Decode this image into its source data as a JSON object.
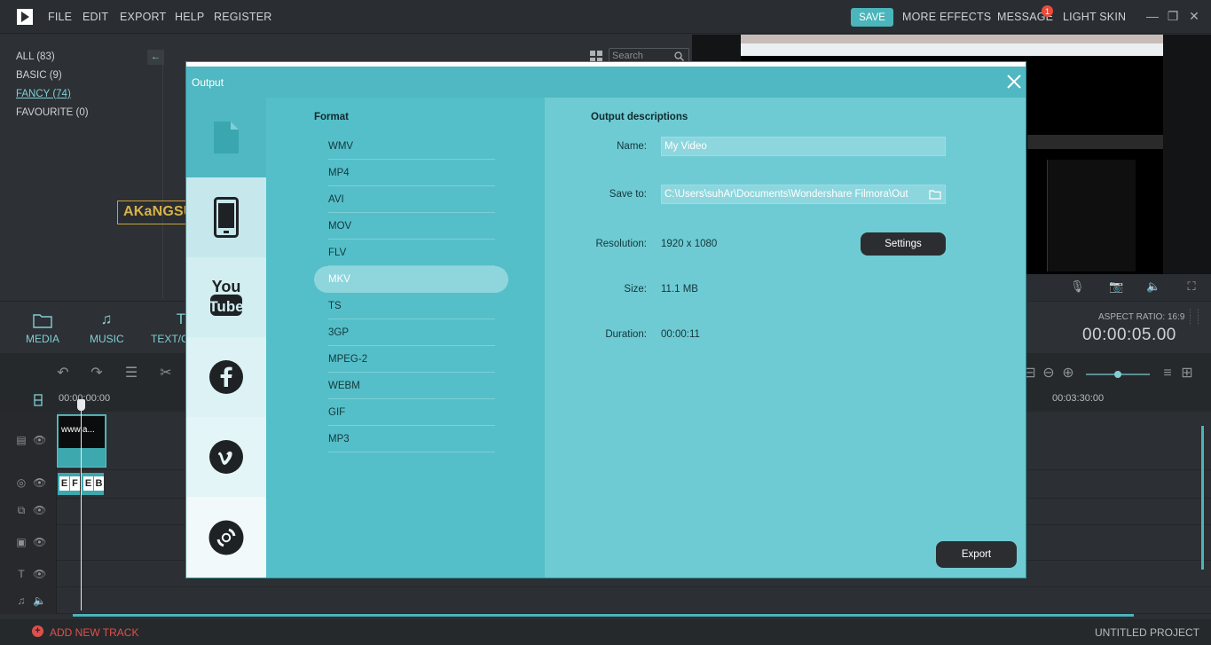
{
  "menu": {
    "items": [
      "FILE",
      "EDIT",
      "EXPORT",
      "HELP",
      "REGISTER"
    ],
    "save": "SAVE",
    "more_effects": "MORE EFFECTS",
    "message": "MESSAGE",
    "message_count": "1",
    "light_skin": "LIGHT SKIN"
  },
  "library": {
    "categories": [
      "ALL (83)",
      "BASIC (9)",
      "FANCY (74)",
      "FAVOURITE (0)"
    ],
    "search_placeholder": "Search"
  },
  "media_bar": {
    "tabs": [
      "MEDIA",
      "MUSIC",
      "TEXT/C"
    ],
    "aspect_ratio": "ASPECT RATIO: 16:9",
    "timecode": "00:00:05.00"
  },
  "timeline": {
    "ruler_start": "00:00:00:00",
    "ruler_mark": "00:03:30:00",
    "clip_text": "www.a...",
    "fx_letters": [
      "E",
      "F",
      "E",
      "B"
    ]
  },
  "bottom": {
    "add_track": "ADD NEW TRACK",
    "project": "UNTITLED PROJECT"
  },
  "watermark": "AKaNGSUHAR",
  "dialog": {
    "title": "Output",
    "format_heading": "Format",
    "formats": [
      "WMV",
      "MP4",
      "AVI",
      "MOV",
      "FLV",
      "MKV",
      "TS",
      "3GP",
      "MPEG-2",
      "WEBM",
      "GIF",
      "MP3"
    ],
    "selected_format": "MKV",
    "desc_heading": "Output descriptions",
    "name_label": "Name:",
    "name_value": "My Video",
    "save_label": "Save to:",
    "save_value": "C:\\Users\\suhAr\\Documents\\Wondershare Filmora\\Out",
    "resolution_label": "Resolution:",
    "resolution_value": "1920 x 1080",
    "settings": "Settings",
    "size_label": "Size:",
    "size_value": "11.1 MB",
    "duration_label": "Duration:",
    "duration_value": "00:00:11",
    "export": "Export",
    "side_tabs": [
      "Local",
      "Device",
      "YouTube",
      "Facebook",
      "Vimeo",
      "DVD"
    ]
  },
  "colors": {
    "accent": "#4ab5bb",
    "dialog_bg": "#4fb8c2",
    "dialog_right": "#6fcbd3",
    "dark_button": "#2b2d30",
    "add_track_red": "#e0504a"
  }
}
